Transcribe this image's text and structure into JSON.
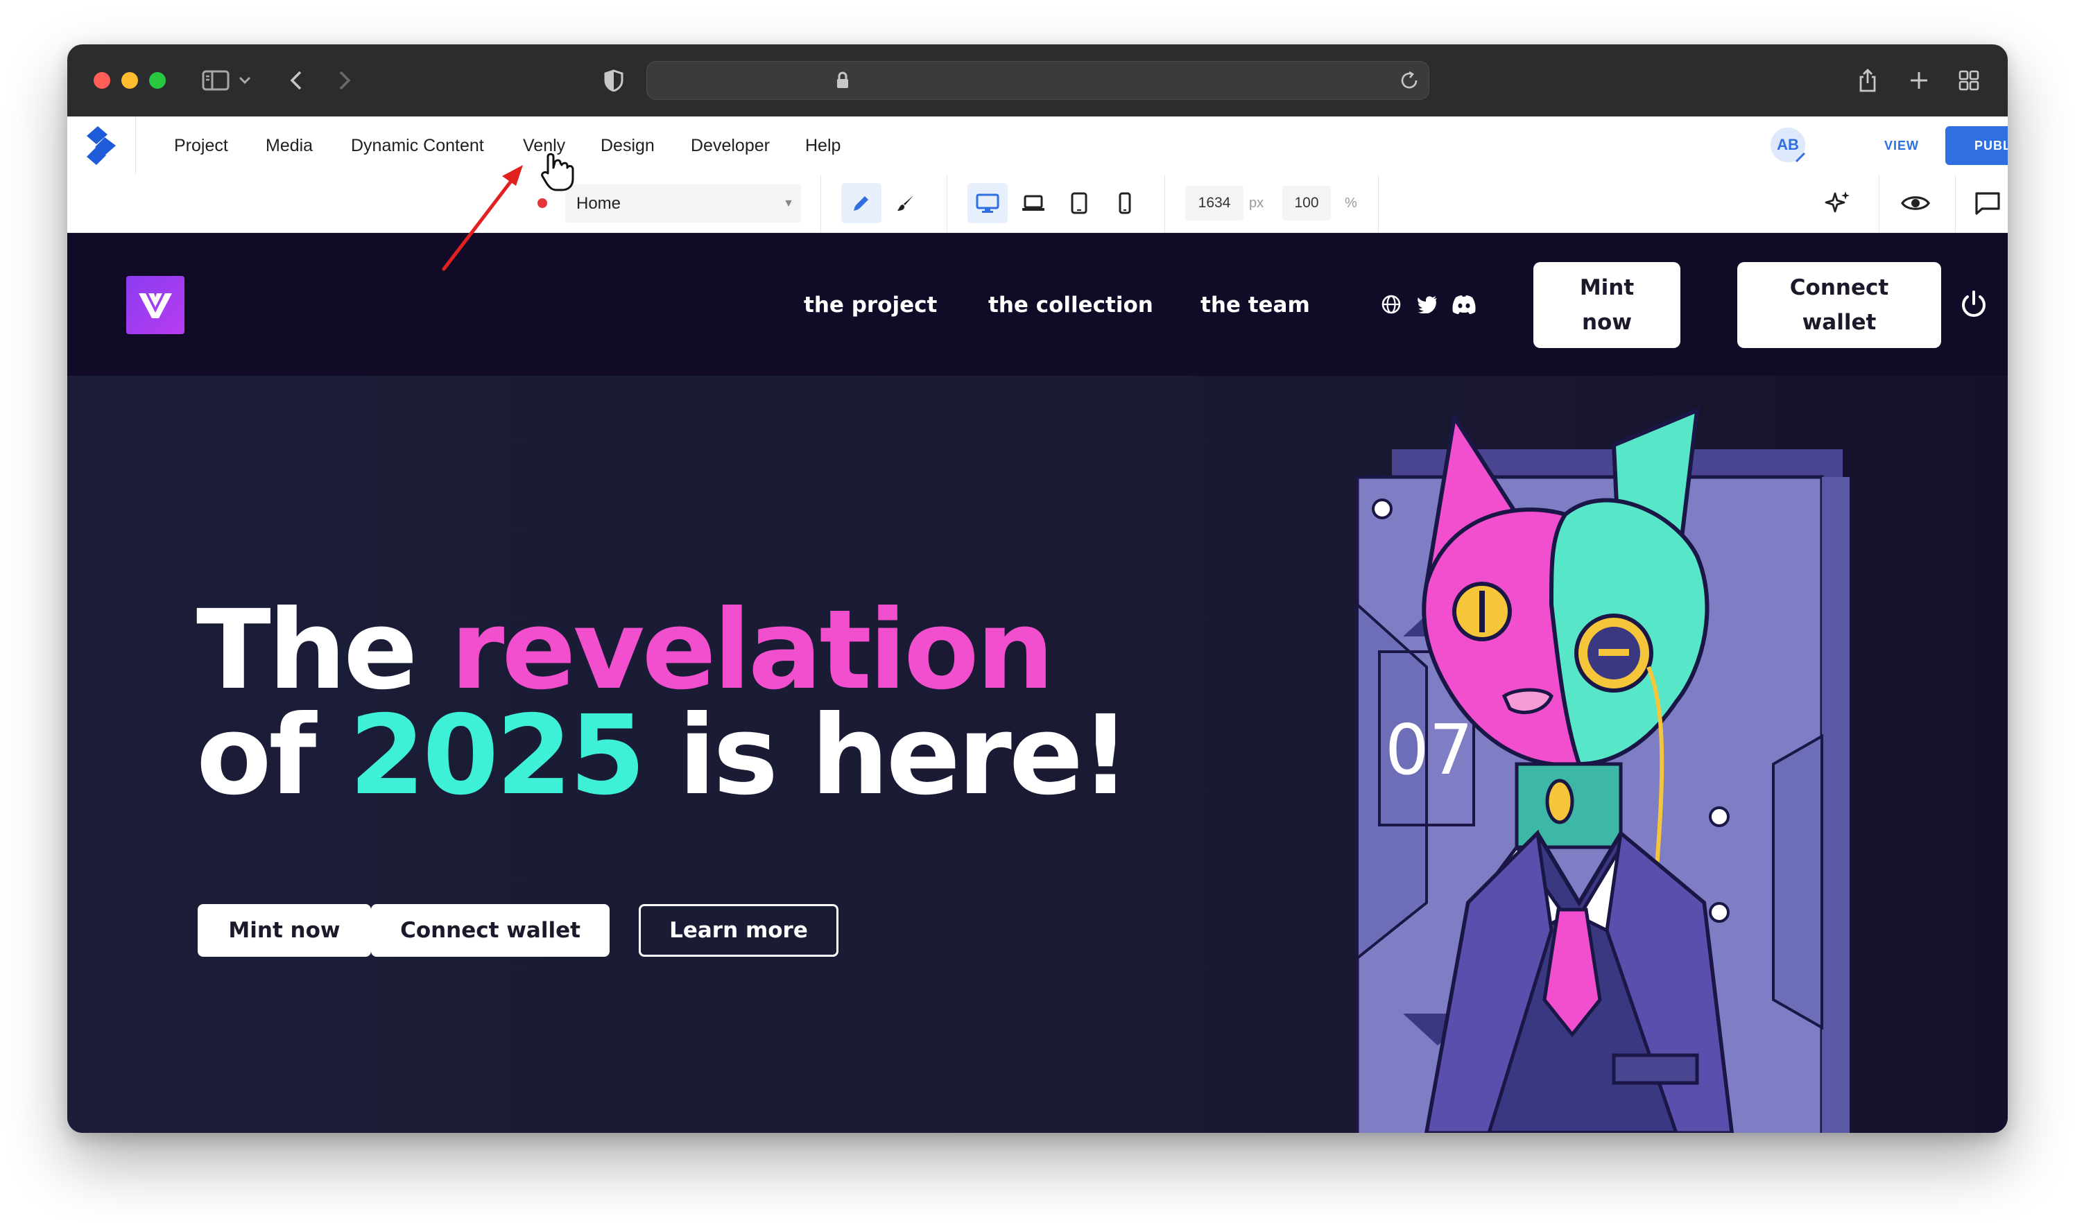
{
  "editor": {
    "menu": [
      {
        "id": "project",
        "label": "Project"
      },
      {
        "id": "media",
        "label": "Media"
      },
      {
        "id": "dynamic-content",
        "label": "Dynamic Content"
      },
      {
        "id": "venly",
        "label": "Venly"
      },
      {
        "id": "design",
        "label": "Design"
      },
      {
        "id": "developer",
        "label": "Developer"
      },
      {
        "id": "help",
        "label": "Help"
      }
    ],
    "avatar_initials": "AB",
    "view_label": "VIEW",
    "publish_label": "PUBL",
    "page_select": "Home",
    "width_value": "1634",
    "width_unit": "px",
    "zoom_value": "100",
    "zoom_unit": "%",
    "accent_color": "#2f6fe0"
  },
  "site": {
    "nav": [
      {
        "label": "the project"
      },
      {
        "label": "the collection"
      },
      {
        "label": "the team"
      }
    ],
    "mint_line1": "Mint",
    "mint_line2": "now",
    "connect_line1": "Connect",
    "connect_line2": "wallet",
    "headline": {
      "the": "The",
      "revelation": "revelation",
      "of": "of",
      "year": "2025",
      "rest": "is here!"
    },
    "buttons": {
      "mint": "Mint now",
      "connect": "Connect wallet",
      "learn": "Learn more"
    },
    "art_counter": "07",
    "colors": {
      "pink": "#f24fce",
      "teal": "#3df0d6",
      "header_bg": "#110b28",
      "hero_bg": "#1b1d38"
    }
  }
}
